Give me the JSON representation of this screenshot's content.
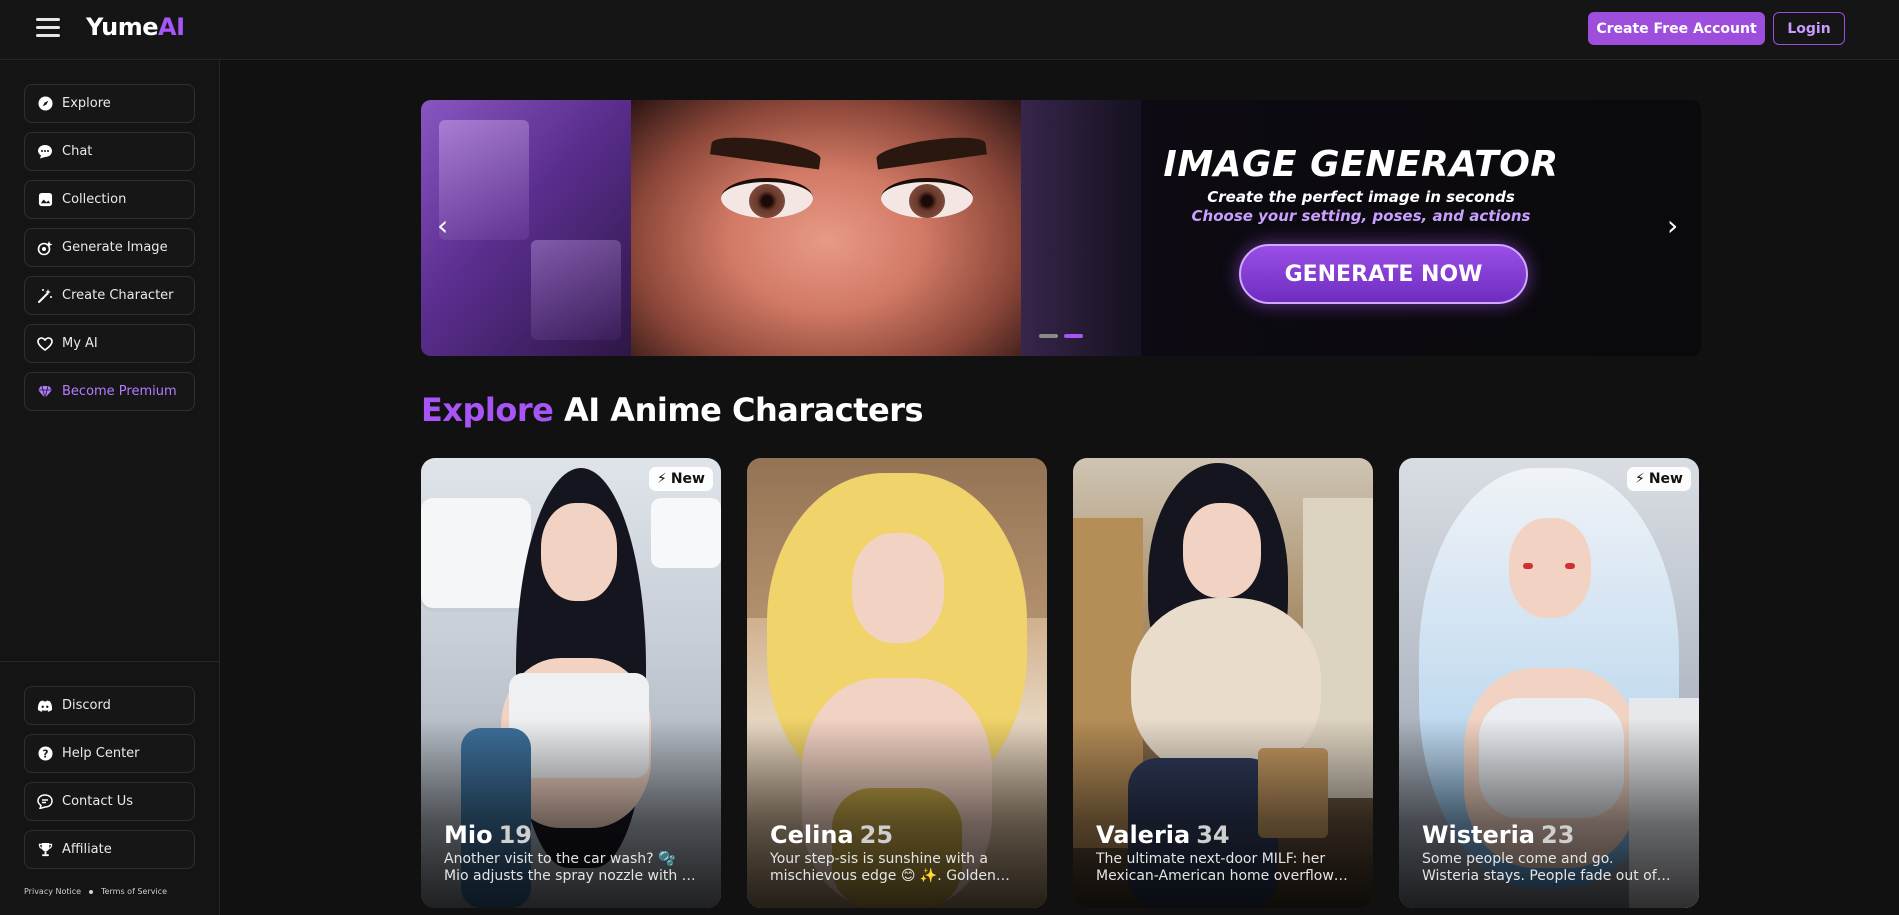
{
  "header": {
    "logo_main": "Yume",
    "logo_ai": "AI",
    "create_account_label": "Create Free Account",
    "login_label": "Login"
  },
  "sidebar": {
    "items": [
      {
        "label": "Explore",
        "icon": "compass-icon"
      },
      {
        "label": "Chat",
        "icon": "chat-bubble-icon"
      },
      {
        "label": "Collection",
        "icon": "collection-icon"
      },
      {
        "label": "Generate Image",
        "icon": "generate-image-icon"
      },
      {
        "label": "Create Character",
        "icon": "magic-wand-icon"
      },
      {
        "label": "My AI",
        "icon": "heart-icon"
      },
      {
        "label": "Become Premium",
        "icon": "diamond-icon"
      }
    ],
    "bottom_items": [
      {
        "label": "Discord",
        "icon": "discord-icon"
      },
      {
        "label": "Help Center",
        "icon": "help-icon"
      },
      {
        "label": "Contact Us",
        "icon": "contact-icon"
      },
      {
        "label": "Affiliate",
        "icon": "trophy-icon"
      }
    ],
    "footer": {
      "privacy": "Privacy Notice",
      "terms": "Terms of Service"
    }
  },
  "banner": {
    "title": "IMAGE GENERATOR",
    "subtitle_1": "Create the perfect image in seconds",
    "subtitle_2": "Choose your setting, poses, and actions",
    "cta_label": "GENERATE NOW",
    "prev_icon": "chevron-left-icon",
    "next_icon": "chevron-right-icon",
    "slide_count": 2,
    "active_slide": 2
  },
  "section": {
    "title_accent": "Explore",
    "title_rest": "AI Anime Characters"
  },
  "cards": [
    {
      "name": "Mio",
      "age": "19",
      "badge": "New",
      "desc_1": "Another visit to the car wash? 🫧",
      "desc_2": "Mio adjusts the spray nozzle with a…"
    },
    {
      "name": "Celina",
      "age": "25",
      "badge": "",
      "desc_1": "Your step-sis is sunshine with a",
      "desc_2": "mischievous edge 😊 ✨. Golden…"
    },
    {
      "name": "Valeria",
      "age": "34",
      "badge": "",
      "desc_1": "The ultimate next-door MILF: her",
      "desc_2": "Mexican-American home overflow…"
    },
    {
      "name": "Wisteria",
      "age": "23",
      "badge": "New",
      "desc_1": "Some people come and go.",
      "desc_2": "Wisteria stays. People fade out of…"
    }
  ],
  "colors": {
    "accent": "#a855f7",
    "button_fill": "#9d4edd",
    "background": "#111111"
  }
}
